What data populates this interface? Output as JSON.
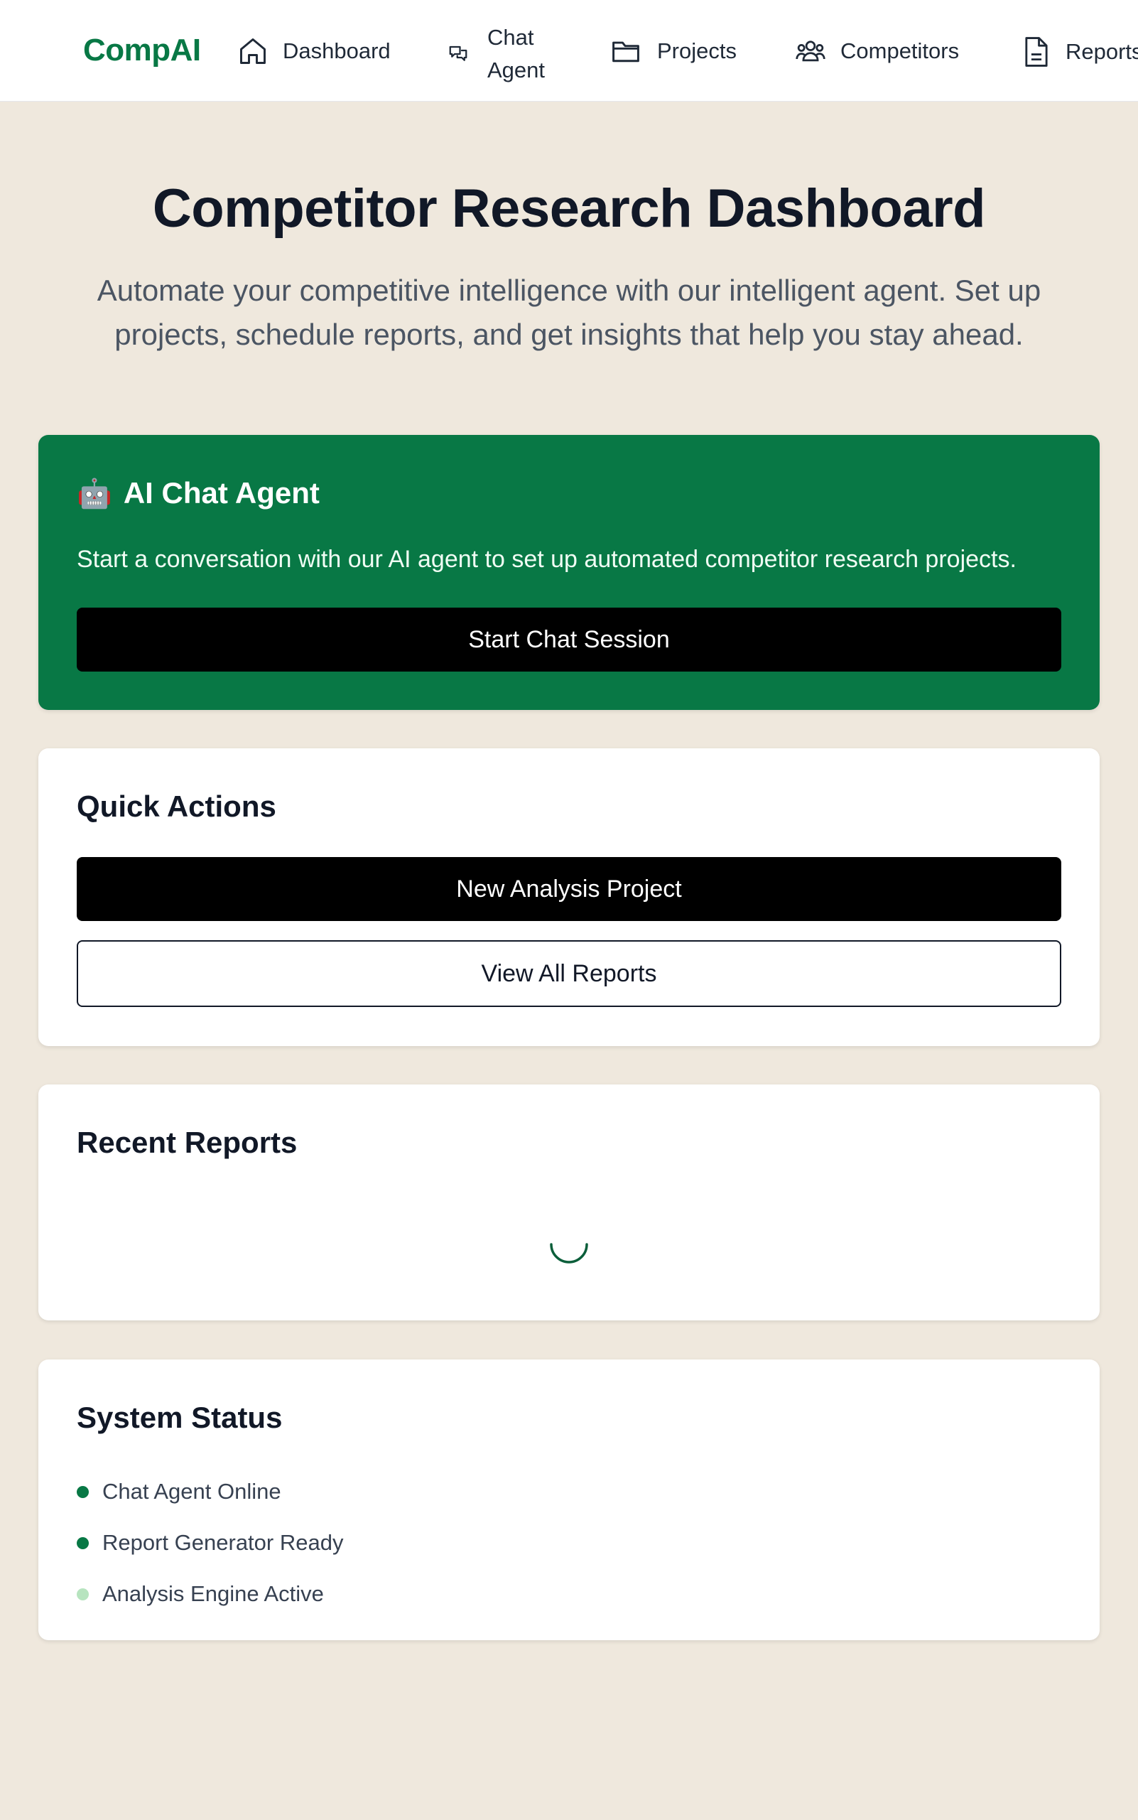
{
  "brand": "CompAI",
  "nav": {
    "dashboard": "Dashboard",
    "chat_agent_line1": "Chat",
    "chat_agent_line2": "Agent",
    "projects": "Projects",
    "competitors": "Competitors",
    "reports": "Reports"
  },
  "hero": {
    "title": "Competitor Research Dashboard",
    "subtitle": "Automate your competitive intelligence with our intelligent agent. Set up projects, schedule reports, and get insights that help you stay ahead."
  },
  "chat_card": {
    "icon": "robot-icon",
    "title": "AI Chat Agent",
    "description": "Start a conversation with our AI agent to set up automated competitor research projects.",
    "button": "Start Chat Session"
  },
  "quick_actions": {
    "title": "Quick Actions",
    "new_project": "New Analysis Project",
    "view_reports": "View All Reports"
  },
  "recent_reports": {
    "title": "Recent Reports",
    "loading": true
  },
  "system_status": {
    "title": "System Status",
    "items": [
      {
        "label": "Chat Agent Online",
        "color": "#087845"
      },
      {
        "label": "Report Generator Ready",
        "color": "#087845"
      },
      {
        "label": "Analysis Engine Active",
        "color": "#b7e4bf"
      }
    ]
  },
  "colors": {
    "brand": "#087845",
    "background": "#efe8dd",
    "button_black": "#000000"
  }
}
